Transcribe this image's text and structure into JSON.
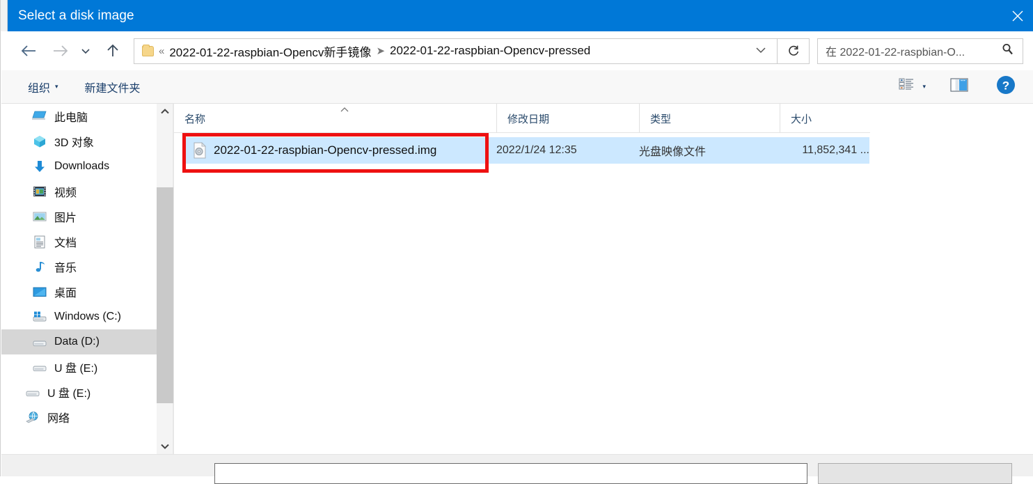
{
  "window": {
    "title": "Select a disk image",
    "titlebar_color": "#0078d7",
    "close_icon": "close-icon"
  },
  "nav": {
    "back_icon": "back-arrow-icon",
    "forward_icon": "forward-arrow-icon",
    "recent_icon": "chevron-down-icon",
    "up_icon": "up-arrow-icon",
    "address": {
      "folder_icon": "folder-icon",
      "overflow": "«",
      "crumbs": [
        "2022-01-22-raspbian-Opencv新手镜像",
        "2022-01-22-raspbian-Opencv-pressed"
      ],
      "separator": "➤",
      "dropdown_icon": "chevron-down-icon"
    },
    "refresh_icon": "refresh-icon",
    "search": {
      "placeholder": "在 2022-01-22-raspbian-O...",
      "icon": "search-icon"
    }
  },
  "toolbar": {
    "organize_label": "组织",
    "organize_caret": "▾",
    "new_folder_label": "新建文件夹",
    "view_icon": "list-view-icon",
    "view_caret": "▾",
    "preview_pane_icon": "preview-pane-icon",
    "help_icon": "help-icon",
    "help_glyph": "?"
  },
  "sidebar": {
    "scroll_up_glyph": "⌃",
    "scroll_down_glyph": "⌄",
    "items": [
      {
        "label": "此电脑",
        "icon": "this-pc-icon",
        "selected": false
      },
      {
        "label": "3D 对象",
        "icon": "3d-objects-icon",
        "selected": false
      },
      {
        "label": "Downloads",
        "icon": "downloads-icon",
        "selected": false
      },
      {
        "label": "视频",
        "icon": "videos-icon",
        "selected": false
      },
      {
        "label": "图片",
        "icon": "pictures-icon",
        "selected": false
      },
      {
        "label": "文档",
        "icon": "documents-icon",
        "selected": false
      },
      {
        "label": "音乐",
        "icon": "music-icon",
        "selected": false
      },
      {
        "label": "桌面",
        "icon": "desktop-icon",
        "selected": false
      },
      {
        "label": "Windows (C:)",
        "icon": "windows-drive-icon",
        "selected": false
      },
      {
        "label": "Data (D:)",
        "icon": "drive-icon",
        "selected": true
      },
      {
        "label": "U 盘 (E:)",
        "icon": "usb-drive-icon",
        "selected": false
      },
      {
        "label": "U 盘 (E:)",
        "icon": "usb-drive-icon",
        "selected": false
      },
      {
        "label": "网络",
        "icon": "network-icon",
        "selected": false
      }
    ]
  },
  "filelist": {
    "columns": {
      "name": "名称",
      "date": "修改日期",
      "type": "类型",
      "size": "大小"
    },
    "sort_caret": "⌃",
    "rows": [
      {
        "icon": "disc-image-file-icon",
        "name": "2022-01-22-raspbian-Opencv-pressed.img",
        "date": "2022/1/24 12:35",
        "type": "光盘映像文件",
        "size": "11,852,341 ..."
      }
    ]
  },
  "annotation": {
    "shape": "rectangle",
    "color": "#ee1111"
  },
  "footer": {
    "filename_value": "",
    "filetype_value": ""
  }
}
